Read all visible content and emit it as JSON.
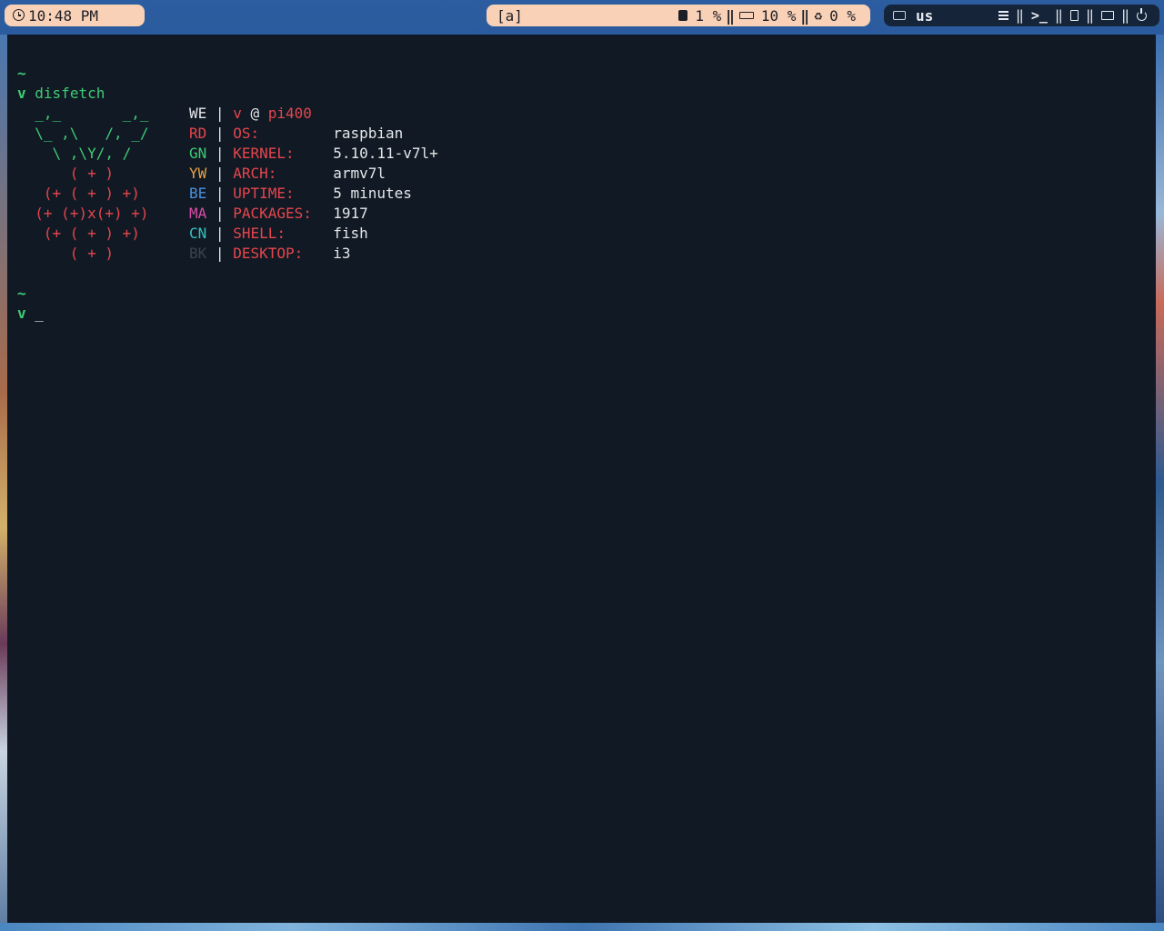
{
  "topbar": {
    "clock": "10:48 PM",
    "workspace": "[a]",
    "cpu": "1 %",
    "ram": "10 %",
    "swap": "0 %",
    "separator": "‖",
    "keyboard_layout": "us"
  },
  "terminal": {
    "prompt_dir": "~",
    "prompt_symbol": "v",
    "command": "disfetch",
    "cursor": "_",
    "ascii_art": [
      "  _,_       _,_",
      "  \\_ ,\\   /, _/",
      "    \\ ,\\Y/, /",
      "      ( + )",
      "   (+ ( + ) +)",
      "  (+ (+)x(+) +)",
      "   (+ ( + ) +)",
      "      ( + )"
    ],
    "header": {
      "code": "WE",
      "pipe": "|",
      "user": "v",
      "at": "@",
      "host": "pi400"
    },
    "info": [
      {
        "code": "RD",
        "pipe": "|",
        "label": "OS:",
        "value": "raspbian"
      },
      {
        "code": "GN",
        "pipe": "|",
        "label": "KERNEL:",
        "value": "5.10.11-v7l+"
      },
      {
        "code": "YW",
        "pipe": "|",
        "label": "ARCH:",
        "value": "armv7l"
      },
      {
        "code": "BE",
        "pipe": "|",
        "label": "UPTIME:",
        "value": "5 minutes"
      },
      {
        "code": "MA",
        "pipe": "|",
        "label": "PACKAGES:",
        "value": "1917"
      },
      {
        "code": "CN",
        "pipe": "|",
        "label": "SHELL:",
        "value": "fish"
      },
      {
        "code": "BK",
        "pipe": "|",
        "label": "DESKTOP:",
        "value": "i3"
      }
    ]
  },
  "colors": {
    "terminal_bg": "#111a24",
    "green": "#3ecb75",
    "red": "#e5454d",
    "bar_pill": "#f9d1b6"
  }
}
